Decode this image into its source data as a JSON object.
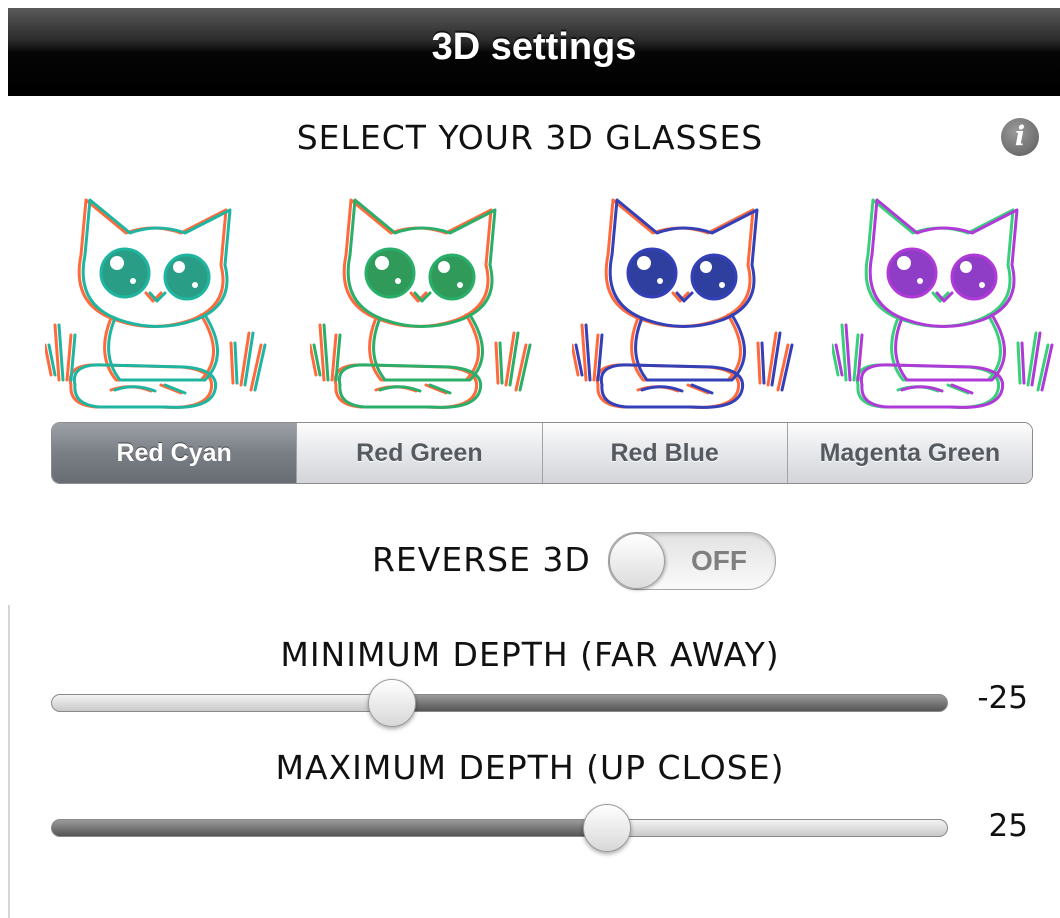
{
  "navbar": {
    "title": "3D settings"
  },
  "glasses": {
    "heading": "SELECT YOUR 3D GLASSES",
    "info_icon": "info-icon",
    "previews": [
      {
        "name": "red-cyan-cat",
        "line_color": "#1fb5a0",
        "eye_color": "#2a9d86",
        "accent": "#ff6a3c"
      },
      {
        "name": "red-green-cat",
        "line_color": "#2aae6a",
        "eye_color": "#2f9a5a",
        "accent": "#ff6a3c"
      },
      {
        "name": "red-blue-cat",
        "line_color": "#3340b8",
        "eye_color": "#2f3fa0",
        "accent": "#ff6a3c"
      },
      {
        "name": "magenta-green-cat",
        "line_color": "#b03ad8",
        "eye_color": "#8f3cc7",
        "accent": "#39d07a"
      }
    ],
    "options": [
      "Red Cyan",
      "Red Green",
      "Red Blue",
      "Magenta Green"
    ],
    "selected_index": 0
  },
  "reverse": {
    "label": "REVERSE 3D",
    "state_text": "OFF",
    "on": false
  },
  "min_depth": {
    "label": "MINIMUM DEPTH (FAR AWAY)",
    "value_text": "-25",
    "fraction": 0.38
  },
  "max_depth": {
    "label": "MAXIMUM DEPTH (UP CLOSE)",
    "value_text": "25",
    "fraction": 0.62
  }
}
